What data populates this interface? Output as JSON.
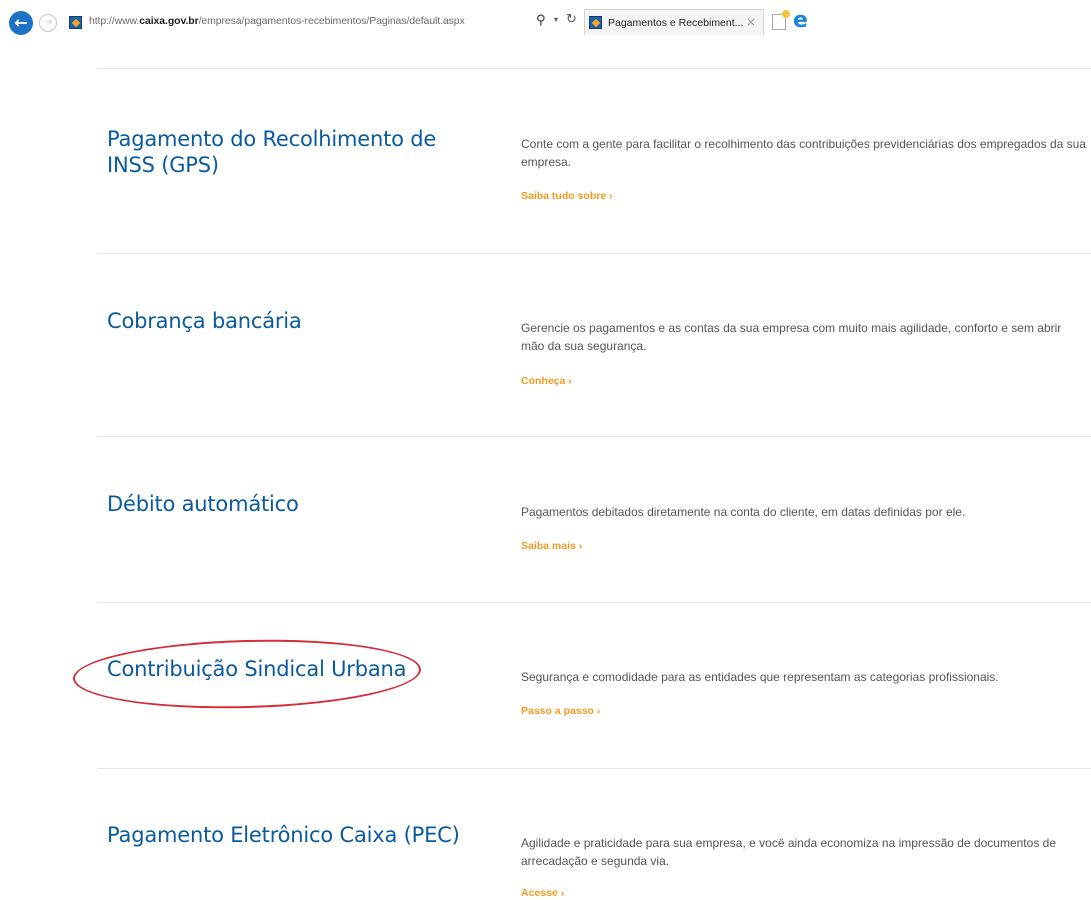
{
  "browser": {
    "url_prefix": "http://www.",
    "url_domain": "caixa.gov.br",
    "url_path": "/empresa/pagamentos-recebimentos/Paginas/default.aspx",
    "search_glyph": "⚲",
    "dropdown_glyph": "▾",
    "refresh_glyph": "↻",
    "tab_title": "Pagamentos e Recebiment...",
    "tab_close": "×",
    "back_glyph": "←",
    "forward_glyph": "→",
    "ie_glyph": "e"
  },
  "sections": [
    {
      "title": "Pagamento do Recolhimento de INSS (GPS)",
      "description": "Conte com a gente para facilitar o recolhimento das contribuições previdenciárias dos empregados da sua empresa.",
      "link": "Saiba tudo sobre ›"
    },
    {
      "title": "Cobrança bancária",
      "description": "Gerencie os pagamentos e as contas da sua empresa com muito mais agilidade, conforto e sem abrir mão da sua segurança.",
      "link": "Conheça ›"
    },
    {
      "title": "Débito automático",
      "description": "Pagamentos debitados diretamente na conta do cliente, em datas definidas por ele.",
      "link": "Saiba mais ›"
    },
    {
      "title": "Contribuição Sindical Urbana",
      "description": "Segurança e comodidade para as entidades que representam as categorias profissionais.",
      "link": "Passo a passo ›"
    },
    {
      "title": "Pagamento Eletrônico Caixa (PEC)",
      "description": "Agilidade e praticidade para sua empresa, e você ainda economiza na impressão de documentos de arrecadação e segunda via.",
      "link": "Acesse ›"
    }
  ],
  "annotation": {
    "color": "#d32f38"
  }
}
